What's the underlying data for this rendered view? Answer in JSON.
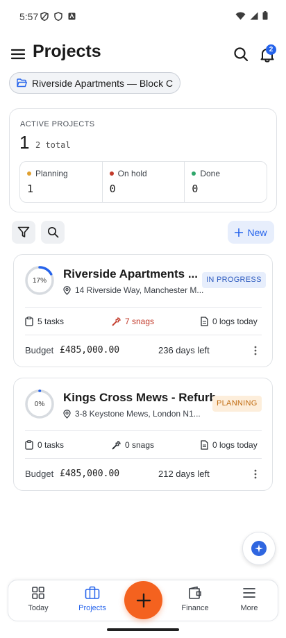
{
  "status_bar": {
    "time": "5:57"
  },
  "header": {
    "title": "Projects",
    "notification_count": "2"
  },
  "project_selector": {
    "label": "Riverside Apartments — Block C"
  },
  "stats": {
    "heading": "ACTIVE PROJECTS",
    "active_count": "1",
    "total_text": "2 total",
    "cells": [
      {
        "label": "Planning",
        "value": "1",
        "color": "#e0a030"
      },
      {
        "label": "On hold",
        "value": "0",
        "color": "#c23a2a"
      },
      {
        "label": "Done",
        "value": "0",
        "color": "#2ea66a"
      }
    ]
  },
  "toolbar": {
    "new_label": "New"
  },
  "projects": [
    {
      "progress_text": "17%",
      "progress": 0.17,
      "title": "Riverside Apartments ...",
      "address": "14 Riverside Way, Manchester M...",
      "status": "IN PROGRESS",
      "tasks": "5 tasks",
      "snags": "7 snags",
      "logs": "0 logs today",
      "budget_label": "Budget",
      "budget": "£485,000.00",
      "days_left": "236 days left"
    },
    {
      "progress_text": "0%",
      "progress": 0.0,
      "title": "Kings Cross Mews - Refurb",
      "address": "3-8 Keystone Mews, London N1...",
      "status": "PLANNING",
      "tasks": "0 tasks",
      "snags": "0 snags",
      "logs": "0 logs today",
      "budget_label": "Budget",
      "budget": "£485,000.00",
      "days_left": "212 days left"
    }
  ],
  "bottom_nav": {
    "items": [
      {
        "label": "Today",
        "icon": "grid-icon"
      },
      {
        "label": "Projects",
        "icon": "briefcase-icon"
      },
      {
        "label": "Finance",
        "icon": "wallet-icon"
      },
      {
        "label": "More",
        "icon": "menu-icon"
      }
    ],
    "active": "Projects"
  },
  "colors": {
    "accent": "#2563eb",
    "fab": "#f4621f",
    "snag_alert": "#c23a2a"
  }
}
